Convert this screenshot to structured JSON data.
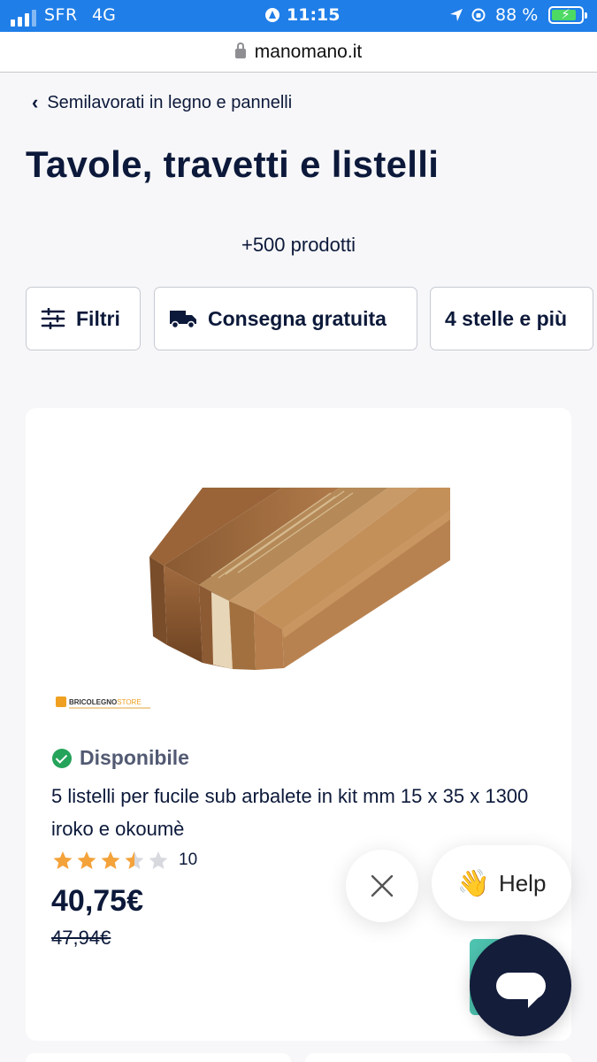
{
  "status_bar": {
    "carrier": "SFR",
    "network": "4G",
    "time": "11:15",
    "battery": "88 %"
  },
  "browser": {
    "url": "manomano.it"
  },
  "breadcrumb": {
    "label": "Semilavorati in legno e pannelli"
  },
  "page": {
    "title": "Tavole, travetti e listelli",
    "product_count": "+500 prodotti"
  },
  "filters": [
    {
      "label": "Filtri",
      "icon": "sliders-icon"
    },
    {
      "label": "Consegna gratuita",
      "icon": "truck-icon"
    },
    {
      "label": "4 stelle e più"
    }
  ],
  "product": {
    "seller_logo": "BRICOLEGNO STORE",
    "seller_logo_part1": "BRICOLEGNO",
    "seller_logo_part2": "STORE",
    "availability": "Disponibile",
    "title": "5 listelli per fucile sub arbalete in kit mm 15 x 35 x 1300 iroko e okoumè",
    "rating_value": 3.5,
    "rating_max": 5,
    "review_count": "10",
    "price": "40,75€",
    "old_price": "47,94€"
  },
  "widgets": {
    "help_label": "Help"
  },
  "colors": {
    "status_bar": "#1f7ee8",
    "text_primary": "#0c193a",
    "available_green": "#24a35a",
    "star_filled": "#f4a23a",
    "star_empty": "#d7d9df",
    "chat_button": "#141d3a",
    "cart_accent": "#4ec4b0"
  }
}
